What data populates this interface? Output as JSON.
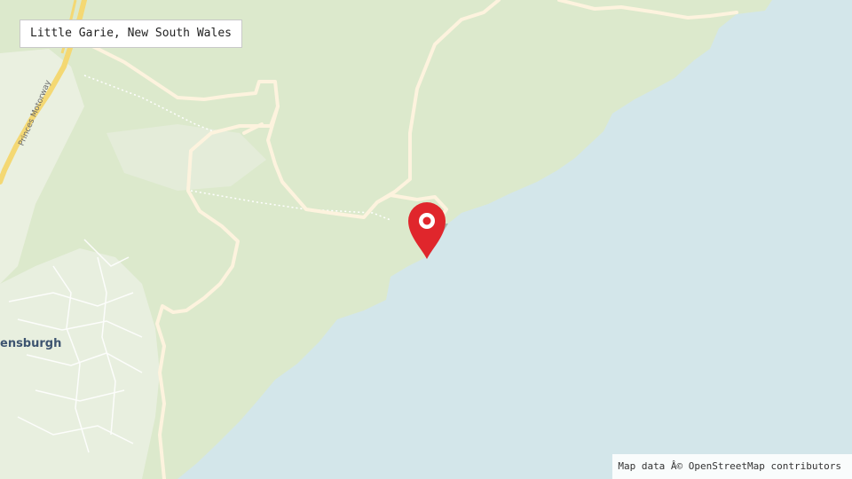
{
  "map": {
    "title": "Little Garie, New South Wales",
    "attribution": "Map data Â© OpenStreetMap contributors",
    "labels": {
      "town": "ensburgh",
      "motorway": "Princes Motorway"
    },
    "marker": {
      "icon": "map-pin-icon",
      "color": "#e0262c"
    },
    "colors": {
      "water": "#d3e6ea",
      "land": "#dce9cc",
      "urban": "#eef2e8",
      "road": "#fdf3de",
      "motorway": "#f4d873"
    }
  }
}
